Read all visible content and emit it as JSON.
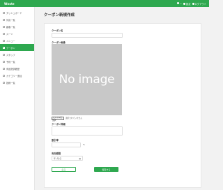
{
  "app": {
    "brand": "Wnote"
  },
  "header": {
    "right_items": [
      {
        "label": "—",
        "icon": "menu-icon"
      },
      {
        "label": "設定",
        "icon": "gear-icon"
      },
      {
        "label": "ログアウト",
        "icon": "logout-icon"
      }
    ]
  },
  "sidebar": {
    "items": [
      {
        "label": "ダッシュボード",
        "active": false
      },
      {
        "label": "対応一覧",
        "active": false
      },
      {
        "label": "顧客一覧",
        "active": false
      },
      {
        "label": "スーツ",
        "active": false
      },
      {
        "label": "メニュー",
        "active": false
      },
      {
        "label": "クーポン",
        "active": true
      },
      {
        "label": "スタッフ",
        "active": false
      },
      {
        "label": "予約一覧",
        "active": false
      },
      {
        "label": "商品提供履歴",
        "active": false
      },
      {
        "label": "カテゴリー追加",
        "active": false
      },
      {
        "label": "投稿一覧",
        "active": false
      }
    ]
  },
  "page": {
    "title": "クーポン新規作成"
  },
  "form": {
    "name_label": "クーポン名",
    "image_label": "クーポン画像",
    "image_placeholder": "No image",
    "file_button": "ファイルを選択",
    "file_text": "選択されていません",
    "detail_label": "クーポン詳細",
    "discount_label": "割引率",
    "discount_suffix": "%",
    "expiry_label": "有効期限",
    "expiry_value": "年 /月/日",
    "back_button": "戻る",
    "save_button": "保存する"
  },
  "colors": {
    "accent": "#2ea84f"
  }
}
